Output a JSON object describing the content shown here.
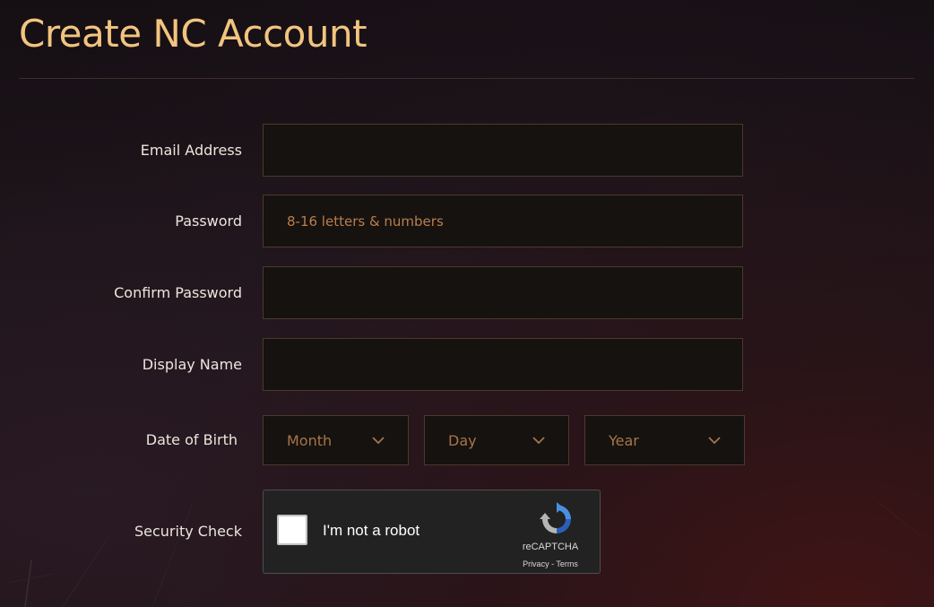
{
  "page": {
    "title": "Create NC Account"
  },
  "form": {
    "email": {
      "label": "Email Address",
      "value": "",
      "placeholder": ""
    },
    "password": {
      "label": "Password",
      "value": "",
      "placeholder": "8-16 letters & numbers"
    },
    "confirm_password": {
      "label": "Confirm Password",
      "value": "",
      "placeholder": ""
    },
    "display_name": {
      "label": "Display Name",
      "value": "",
      "placeholder": ""
    },
    "date_of_birth": {
      "label": "Date of Birth",
      "month": {
        "selected": "Month",
        "icon": "chevron-down-icon"
      },
      "day": {
        "selected": "Day",
        "icon": "chevron-down-icon"
      },
      "year": {
        "selected": "Year",
        "icon": "chevron-down-icon"
      }
    },
    "security_check": {
      "label": "Security Check",
      "checkbox_label": "I'm not a robot",
      "brand": "reCAPTCHA",
      "privacy_link": "Privacy",
      "separator": " - ",
      "terms_link": "Terms",
      "icon": "recaptcha-logo-icon"
    }
  },
  "colors": {
    "title": "#f2c47e",
    "field_background": "#16120f",
    "field_border": "#4a3a2c",
    "placeholder": "#b97e4e",
    "select_text": "#a77549",
    "recaptcha_background": "#222222"
  }
}
